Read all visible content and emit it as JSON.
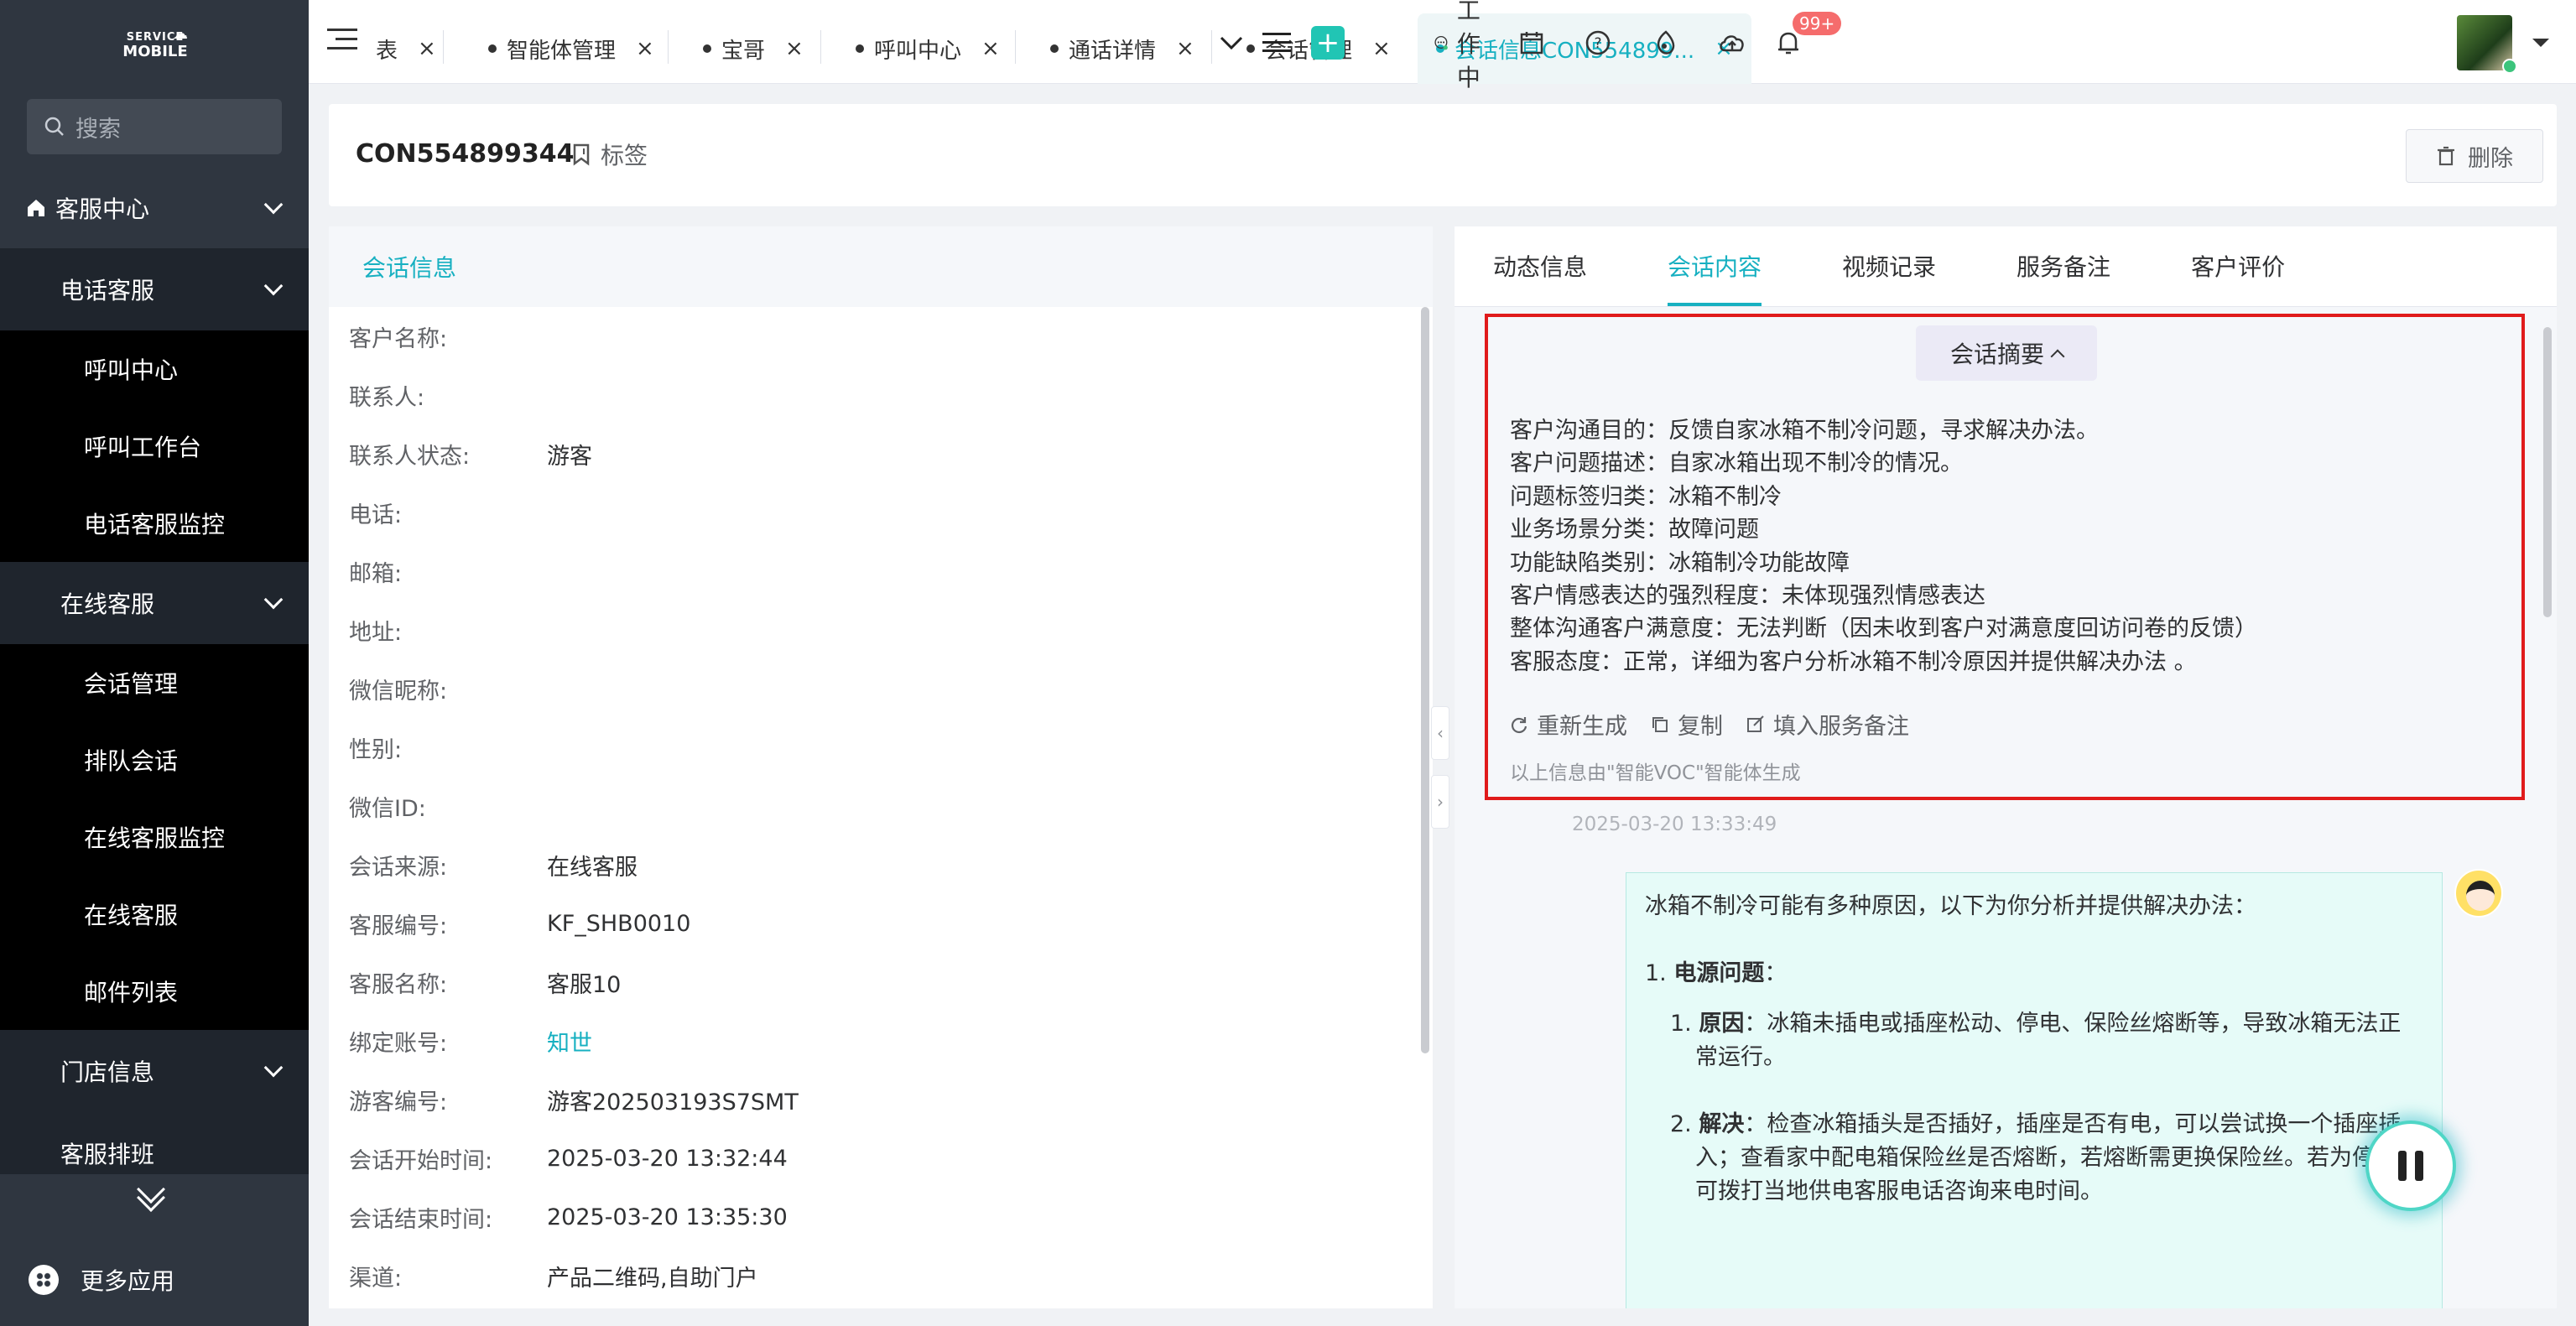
{
  "brand": {
    "logo_line1": "SERVICE",
    "logo_line2": "MOBILE"
  },
  "sidebar": {
    "search_placeholder": "搜索",
    "top_menu": "客服中心",
    "groups": [
      {
        "label": "电话客服",
        "items": [
          "呼叫中心",
          "呼叫工作台",
          "电话客服监控"
        ]
      },
      {
        "label": "在线客服",
        "items": [
          "会话管理",
          "排队会话",
          "在线客服监控",
          "在线客服",
          "邮件列表"
        ]
      },
      {
        "label": "门店信息",
        "items": []
      },
      {
        "label": "客服排班",
        "items": []
      }
    ],
    "more_apps": "更多应用"
  },
  "tabs": [
    {
      "label": "表",
      "dot": false
    },
    {
      "label": "智能体管理",
      "dot": true
    },
    {
      "label": "宝哥",
      "dot": true
    },
    {
      "label": "呼叫中心",
      "dot": true
    },
    {
      "label": "通话详情",
      "dot": true
    },
    {
      "label": "会话管理",
      "dot": true
    },
    {
      "label": "会话信息CON554899...",
      "dot": true,
      "active": true
    }
  ],
  "topbar": {
    "status": "工作中",
    "notify_badge": "99+"
  },
  "header": {
    "conversation_id": "CON554899344",
    "tag_label": "标签",
    "delete_label": "删除"
  },
  "left_panel": {
    "title": "会话信息",
    "rows": [
      {
        "k": "客户名称:",
        "v": ""
      },
      {
        "k": "联系人:",
        "v": ""
      },
      {
        "k": "联系人状态:",
        "v": "游客"
      },
      {
        "k": "电话:",
        "v": ""
      },
      {
        "k": "邮箱:",
        "v": ""
      },
      {
        "k": "地址:",
        "v": ""
      },
      {
        "k": "微信昵称:",
        "v": ""
      },
      {
        "k": "性别:",
        "v": ""
      },
      {
        "k": "微信ID:",
        "v": ""
      },
      {
        "k": "会话来源:",
        "v": "在线客服"
      },
      {
        "k": "客服编号:",
        "v": "KF_SHB0010"
      },
      {
        "k": "客服名称:",
        "v": "客服10"
      },
      {
        "k": "绑定账号:",
        "v": "知世",
        "link": true
      },
      {
        "k": "游客编号:",
        "v": "游客202503193S7SMT"
      },
      {
        "k": "会话开始时间:",
        "v": "2025-03-20 13:32:44"
      },
      {
        "k": "会话结束时间:",
        "v": "2025-03-20 13:35:30"
      },
      {
        "k": "渠道:",
        "v": "产品二维码,自助门户"
      }
    ]
  },
  "right_panel": {
    "tabs": [
      "动态信息",
      "会话内容",
      "视频记录",
      "服务备注",
      "客户评价"
    ],
    "active_tab": 1,
    "summary": {
      "title": "会话摘要",
      "lines": [
        "客户沟通目的：反馈自家冰箱不制冷问题，寻求解决办法。",
        "客户问题描述：自家冰箱出现不制冷的情况。",
        "问题标签归类：冰箱不制冷",
        "业务场景分类：故障问题",
        "功能缺陷类别：冰箱制冷功能故障",
        "客户情感表达的强烈程度：未体现强烈情感表达",
        "整体沟通客户满意度：无法判断（因未收到客户对满意度回访问卷的反馈）",
        "客服态度：正常，详细为客户分析冰箱不制冷原因并提供解决办法 。"
      ],
      "actions": [
        "重新生成",
        "复制",
        "填入服务备注"
      ],
      "footer": "以上信息由\"智能VOC\"智能体生成"
    },
    "timestamp": "2025-03-20 13:33:49",
    "message": {
      "intro": "冰箱不制冷可能有多种原因，以下为你分析并提供解决办法：",
      "section_num": "1.",
      "section_title": "电源问题",
      "section_colon": "：",
      "items": [
        {
          "num": "1.",
          "label": "原因",
          "text": "：冰箱未插电或插座松动、停电、保险丝熔断等，导致冰箱无法正常运行。"
        },
        {
          "num": "2.",
          "label": "解决",
          "text": "：检查冰箱插头是否插好，插座是否有电，可以尝试换一个插座插入；查看家中配电箱保险丝是否熔断，若熔断需更换保险丝。若为停电，可拨打当地供电客服电话咨询来电时间。"
        }
      ]
    }
  }
}
